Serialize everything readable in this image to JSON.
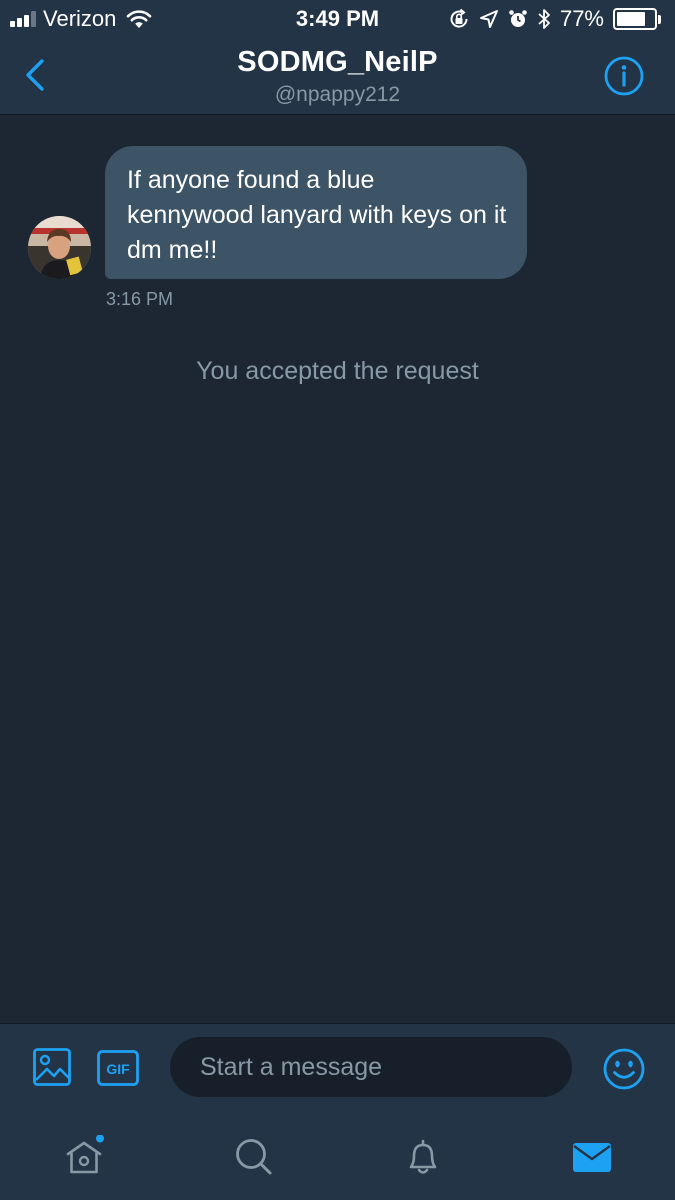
{
  "status_bar": {
    "carrier": "Verizon",
    "time": "3:49 PM",
    "battery_percent": "77%",
    "battery_level": 0.77,
    "icons": [
      "signal-icon",
      "wifi-icon",
      "orientation-lock-icon",
      "location-arrow-icon",
      "alarm-icon",
      "bluetooth-icon",
      "battery-icon"
    ]
  },
  "header": {
    "title": "SODMG_NeilP",
    "handle": "@npappy212",
    "back_icon": "chevron-left-icon",
    "info_icon": "info-icon"
  },
  "conversation": {
    "messages": [
      {
        "sender": "incoming",
        "text": "If anyone found a blue kennywood lanyard with keys on it dm me!!",
        "time": "3:16 PM"
      }
    ],
    "system_note": "You accepted the request"
  },
  "composer": {
    "placeholder": "Start a message",
    "value": "",
    "gif_label": "GIF",
    "icons": [
      "image-icon",
      "gif-icon",
      "emoji-icon"
    ]
  },
  "tab_bar": {
    "tabs": [
      {
        "name": "home",
        "icon": "home-icon",
        "has_notification_dot": true
      },
      {
        "name": "search",
        "icon": "search-icon"
      },
      {
        "name": "notifications",
        "icon": "bell-icon"
      },
      {
        "name": "messages",
        "icon": "envelope-icon",
        "active": true
      }
    ]
  },
  "colors": {
    "accent": "#1da1f2",
    "background": "#1c2733",
    "bar": "#243447",
    "bubble": "#3d5466",
    "muted_text": "#8899a6",
    "input_background": "#17202a"
  }
}
